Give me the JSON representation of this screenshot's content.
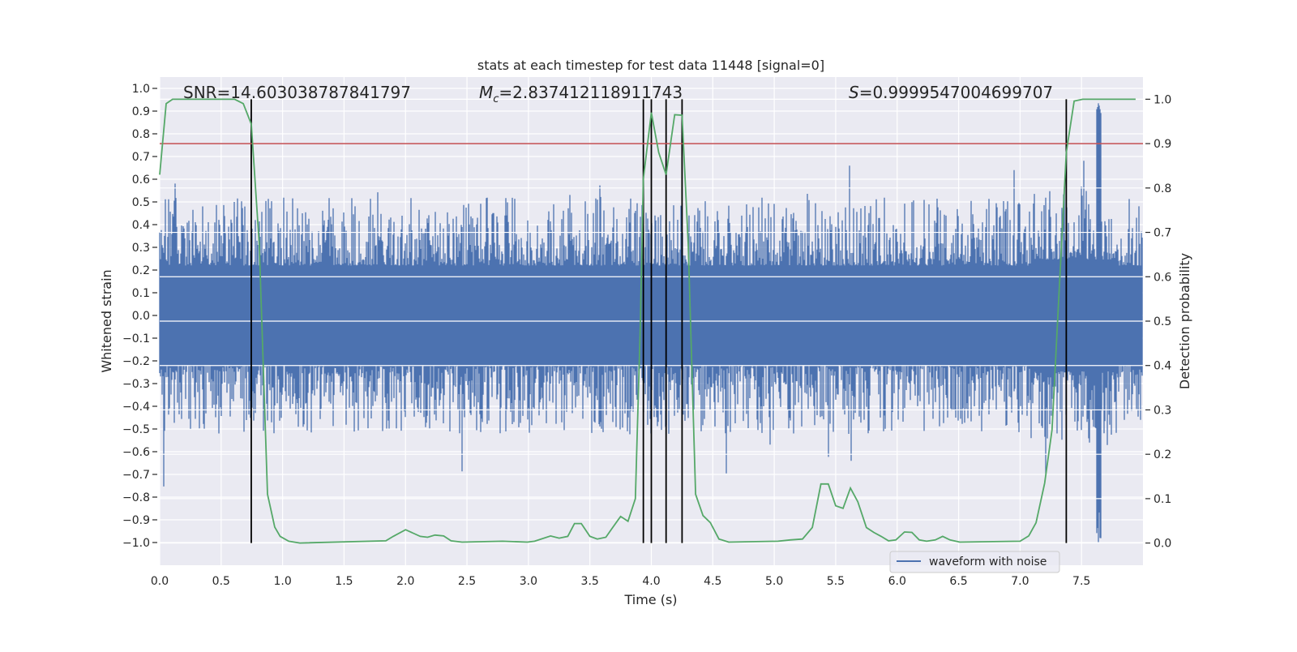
{
  "chart_data": {
    "type": "line",
    "title": "stats at each timestep for test data 11448 [signal=0]",
    "xlabel": "Time (s)",
    "ylabel_left": "Whitened strain",
    "ylabel_right": "Detection probability",
    "xlim": [
      0,
      8
    ],
    "ylim_left": [
      -1.1,
      1.05
    ],
    "ylim_right": [
      -0.05,
      1.05
    ],
    "grid": true,
    "x_ticks": [
      "0.0",
      "0.5",
      "1.0",
      "1.5",
      "2.0",
      "2.5",
      "3.0",
      "3.5",
      "4.0",
      "4.5",
      "5.0",
      "5.5",
      "6.0",
      "6.5",
      "7.0",
      "7.5"
    ],
    "y_ticks_left": [
      "1.0",
      "0.9",
      "0.8",
      "0.7",
      "0.6",
      "0.5",
      "0.4",
      "0.3",
      "0.2",
      "0.1",
      "0.0",
      "−0.1",
      "−0.2",
      "−0.3",
      "−0.4",
      "−0.5",
      "−0.6",
      "−0.7",
      "−0.8",
      "−0.9",
      "−1.0"
    ],
    "y_ticks_right": [
      "1.0",
      "0.9",
      "0.8",
      "0.7",
      "0.6",
      "0.5",
      "0.4",
      "0.3",
      "0.2",
      "0.1",
      "0.0"
    ],
    "annotations": {
      "snr": "SNR=14.603038787841797",
      "mc_symbol": "M",
      "mc_sub": "c",
      "mc_value": "=2.837412118911743",
      "s_symbol": "S",
      "s_value": "=0.9999547004699707"
    },
    "legend": {
      "placement": "lower-right",
      "entries": [
        "waveform with noise"
      ]
    },
    "threshold": {
      "axis": "right",
      "value": 0.9,
      "color": "#c44e52"
    },
    "event_markers": {
      "times": [
        0.745,
        3.935,
        4.0,
        4.12,
        4.25,
        7.376
      ],
      "from": 0.0,
      "to": 1.0,
      "color": "#000000"
    },
    "series": [
      {
        "name": "waveform with noise",
        "axis": "left",
        "kind": "noise-waveform",
        "color": "#4c72b0",
        "typical_peak": 0.5,
        "max": 0.95,
        "min": -1.0
      },
      {
        "axis": "right",
        "color": "#55a868",
        "x": [
          0,
          0.053,
          0.105,
          0.61,
          0.68,
          0.745,
          0.81,
          0.877,
          0.936,
          0.98,
          1.05,
          1.14,
          1.84,
          1.9,
          2.0,
          2.12,
          2.18,
          2.24,
          2.31,
          2.37,
          2.46,
          2.79,
          2.99,
          3.05,
          3.18,
          3.25,
          3.32,
          3.375,
          3.43,
          3.5,
          3.56,
          3.63,
          3.68,
          3.75,
          3.81,
          3.87,
          3.91,
          3.935,
          4.0,
          4.06,
          4.12,
          4.19,
          4.25,
          4.3,
          4.36,
          4.42,
          4.48,
          4.55,
          4.63,
          5.03,
          5.13,
          5.23,
          5.31,
          5.38,
          5.44,
          5.5,
          5.56,
          5.62,
          5.68,
          5.75,
          5.81,
          5.87,
          5.93,
          5.99,
          6.06,
          6.12,
          6.18,
          6.24,
          6.31,
          6.37,
          6.43,
          6.51,
          7.0,
          7.07,
          7.13,
          7.2,
          7.26,
          7.32,
          7.376,
          7.44,
          7.51,
          7.94
        ],
        "y": [
          0.83,
          0.99,
          1.0,
          1.0,
          0.99,
          0.944,
          0.674,
          0.11,
          0.036,
          0.015,
          0.004,
          0.0,
          0.005,
          0.015,
          0.03,
          0.015,
          0.013,
          0.018,
          0.016,
          0.005,
          0.002,
          0.004,
          0.002,
          0.004,
          0.016,
          0.011,
          0.015,
          0.044,
          0.044,
          0.015,
          0.009,
          0.013,
          0.033,
          0.06,
          0.049,
          0.1,
          0.49,
          0.82,
          0.97,
          0.88,
          0.83,
          0.965,
          0.964,
          0.674,
          0.11,
          0.062,
          0.046,
          0.009,
          0.002,
          0.004,
          0.007,
          0.009,
          0.035,
          0.133,
          0.133,
          0.084,
          0.078,
          0.124,
          0.093,
          0.035,
          0.024,
          0.015,
          0.005,
          0.007,
          0.025,
          0.024,
          0.007,
          0.004,
          0.007,
          0.015,
          0.007,
          0.002,
          0.004,
          0.016,
          0.046,
          0.135,
          0.255,
          0.58,
          0.88,
          0.996,
          1.0,
          1.0
        ]
      }
    ],
    "colors": {
      "background": "#eaeaf2",
      "grid": "#ffffff"
    }
  }
}
